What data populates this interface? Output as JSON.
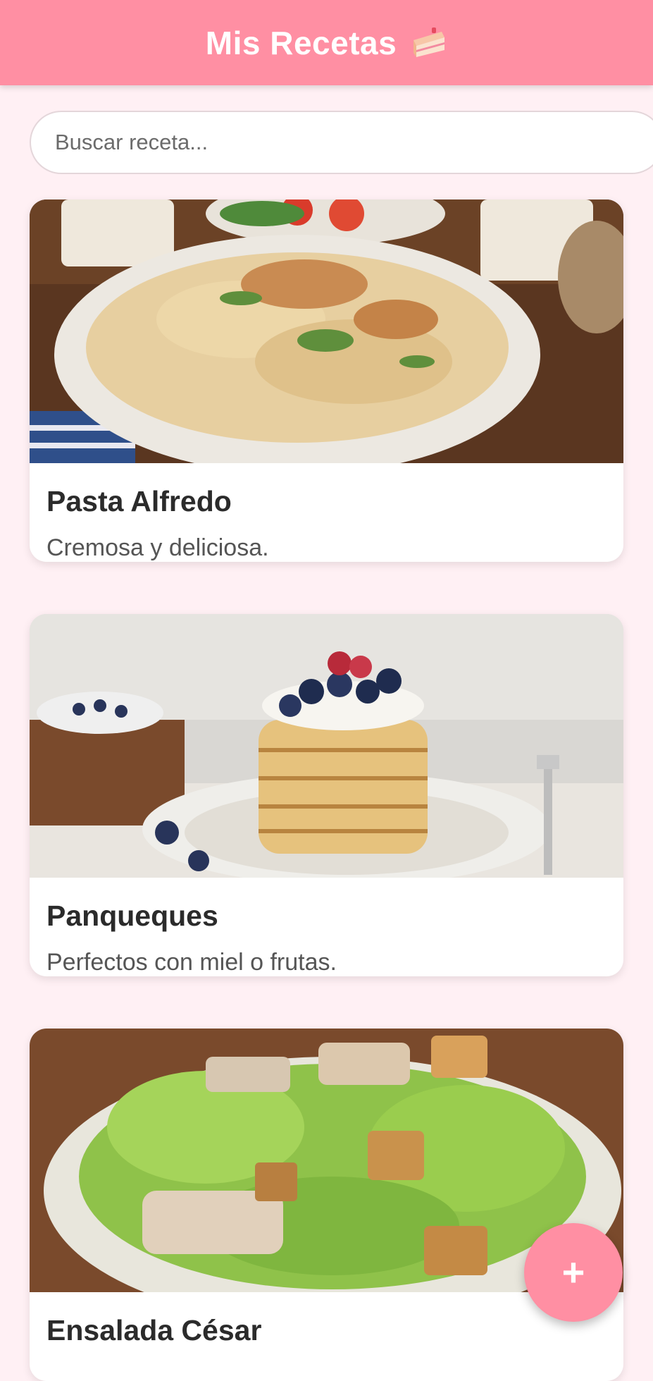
{
  "header": {
    "title": "Mis Recetas",
    "icon": "cake-icon"
  },
  "search": {
    "placeholder": "Buscar receta..."
  },
  "recipes": [
    {
      "title": "Pasta Alfredo",
      "description": "Cremosa y deliciosa.",
      "image": "pasta-image"
    },
    {
      "title": "Panqueques",
      "description": "Perfectos con miel o frutas.",
      "image": "pancakes-image"
    },
    {
      "title": "Ensalada César",
      "description": "",
      "image": "caesar-salad-image"
    }
  ],
  "fab": {
    "label": "+"
  },
  "colors": {
    "accent": "#ff8fa3",
    "background": "#fff0f4",
    "card": "#ffffff"
  }
}
